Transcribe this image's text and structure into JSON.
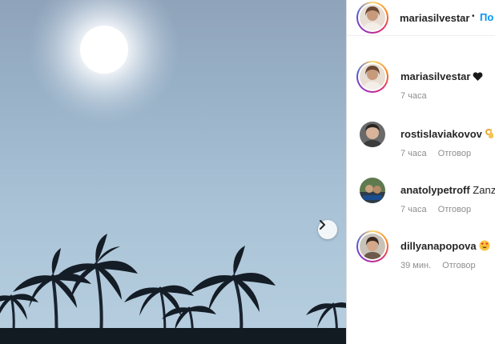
{
  "post": {
    "image_alt": "sky with sun and palm trees",
    "next_icon": "chevron-right-icon"
  },
  "header": {
    "username": "mariasilvestar",
    "separator": "•",
    "follow_label": "По"
  },
  "comments": [
    {
      "username": "mariasilvestar",
      "text": "",
      "emoji": "black-heart-emoji",
      "time": "7 часа",
      "reply": ""
    },
    {
      "username": "rostislaviakovov",
      "text": "",
      "emoji": "ok-hand-emoji",
      "time": "7 часа",
      "reply": "Отговор"
    },
    {
      "username": "anatolypetroff",
      "text": "Zanz",
      "emoji": "",
      "time": "7 часа",
      "reply": "Отговор"
    },
    {
      "username": "dillyanapopova",
      "text": "",
      "emoji": "heart-eyes-emoji",
      "time": "39 мин.",
      "reply": "Отговор"
    }
  ],
  "colors": {
    "link": "#0095f6",
    "text": "#262626",
    "meta": "#8e8e8e",
    "divider": "#dbdbdb"
  }
}
